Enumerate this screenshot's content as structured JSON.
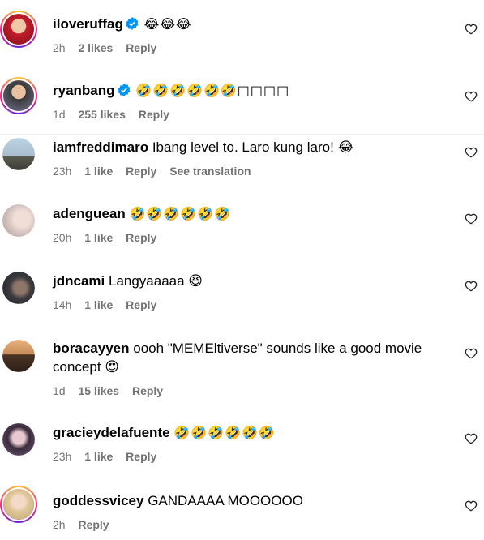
{
  "comments": [
    {
      "username": "iloveruffag",
      "verified": true,
      "text": "😂😂😂",
      "time": "2h",
      "likes": "2 likes",
      "reply": "Reply",
      "translate": ""
    },
    {
      "username": "ryanbang",
      "verified": true,
      "text": "🤣🤣🤣🤣🤣🤣□□□□",
      "time": "1d",
      "likes": "255 likes",
      "reply": "Reply",
      "translate": ""
    },
    {
      "username": "iamfreddimaro",
      "verified": false,
      "text": "Ibang level to. Laro kung laro! 😂",
      "time": "23h",
      "likes": "1 like",
      "reply": "Reply",
      "translate": "See translation"
    },
    {
      "username": "adenguean",
      "verified": false,
      "text": "🤣🤣🤣🤣🤣🤣",
      "time": "20h",
      "likes": "1 like",
      "reply": "Reply",
      "translate": ""
    },
    {
      "username": "jdncami",
      "verified": false,
      "text": "Langyaaaaa 😆",
      "time": "14h",
      "likes": "1 like",
      "reply": "Reply",
      "translate": ""
    },
    {
      "username": "boracayyen",
      "verified": false,
      "text": "oooh \"MEMEltiverse\" sounds like a good movie concept 😍",
      "time": "1d",
      "likes": "15 likes",
      "reply": "Reply",
      "translate": ""
    },
    {
      "username": "gracieydelafuente",
      "verified": false,
      "text": "🤣🤣🤣🤣🤣🤣",
      "time": "23h",
      "likes": "1 like",
      "reply": "Reply",
      "translate": ""
    },
    {
      "username": "goddessvicey",
      "verified": false,
      "text": "GANDAAAA MOOOOOO",
      "time": "2h",
      "likes": "",
      "reply": "Reply",
      "translate": ""
    }
  ],
  "colors": {
    "text": "#000000",
    "meta": "#737373",
    "verified": "#0095f6",
    "divider": "#efefef",
    "story_ring": "#ee2a7b"
  },
  "icons": {
    "verified": "verified-badge-icon",
    "like": "heart-outline-icon"
  }
}
